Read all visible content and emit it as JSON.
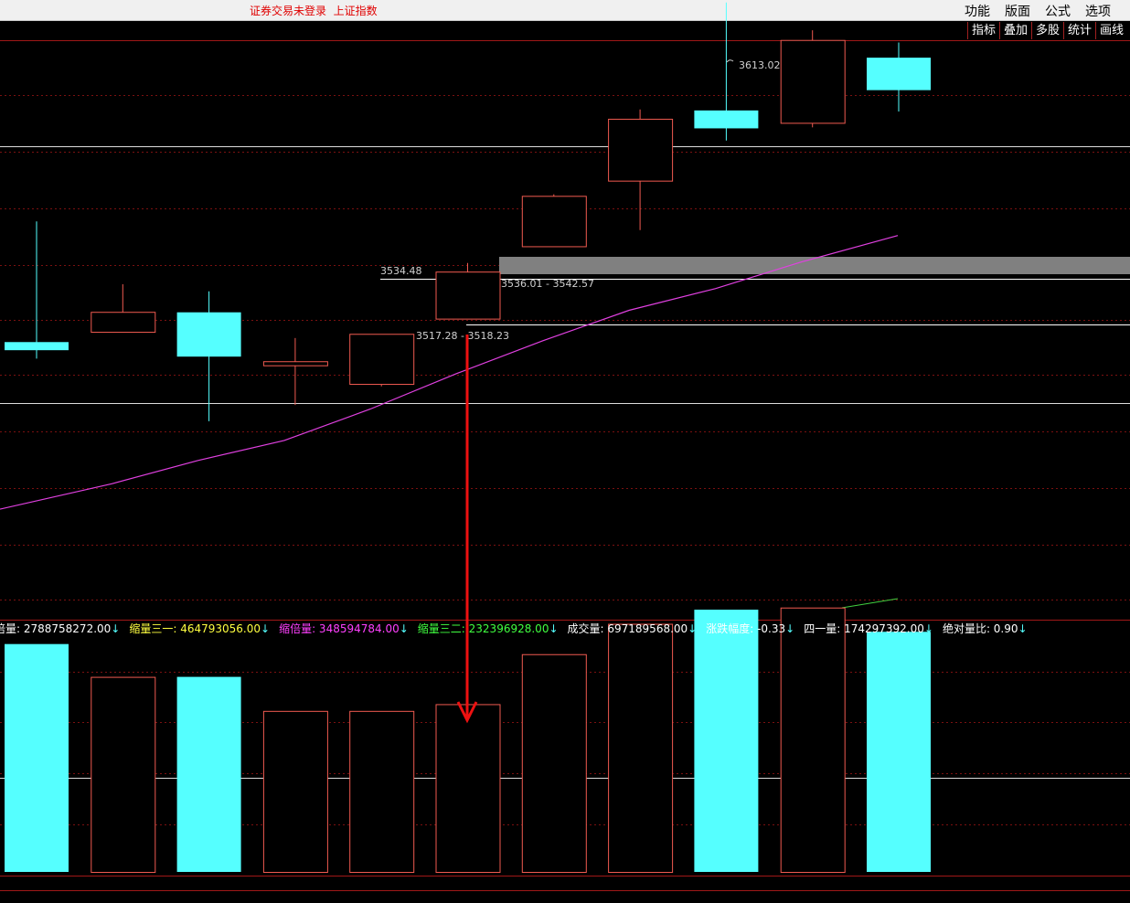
{
  "topbar": {
    "status": "证券交易未登录  上证指数",
    "menu": [
      "功能",
      "版面",
      "公式",
      "选项"
    ]
  },
  "tools": [
    "指标",
    "叠加",
    "多股",
    "统计",
    "画线"
  ],
  "colors": {
    "up": "#f05a50",
    "down": "#55ffff",
    "ma": "#e040e0",
    "grid": "#7a1010",
    "arrow": "#ee1111"
  },
  "chart_data": [
    {
      "type": "candlestick",
      "annotations": {
        "high_label": "3613.02",
        "level_label": "3534.48",
        "range_label_1": "3536.01 - 3542.57",
        "range_label_2": "3517.28 - 3518.23"
      },
      "candles": [
        {
          "open": 3512.6,
          "close": 3510.2,
          "high": 3548.3,
          "low": 3507.7,
          "dir": "down"
        },
        {
          "open": 3515.5,
          "close": 3521.4,
          "high": 3529.7,
          "low": 3515.5,
          "dir": "up"
        },
        {
          "open": 3521.4,
          "close": 3508.3,
          "high": 3527.6,
          "low": 3489.2,
          "dir": "down"
        },
        {
          "open": 3505.6,
          "close": 3506.8,
          "high": 3513.8,
          "low": 3494.0,
          "dir": "up"
        },
        {
          "open": 3500.1,
          "close": 3514.9,
          "high": 3514.9,
          "low": 3499.5,
          "dir": "up"
        },
        {
          "open": 3519.4,
          "close": 3533.3,
          "high": 3536.0,
          "low": 3519.4,
          "dir": "up"
        },
        {
          "open": 3540.8,
          "close": 3555.7,
          "high": 3556.3,
          "low": 3540.8,
          "dir": "up"
        },
        {
          "open": 3560.2,
          "close": 3578.5,
          "high": 3581.4,
          "low": 3545.7,
          "dir": "up"
        },
        {
          "open": 3581.1,
          "close": 3575.8,
          "high": 3613.0,
          "low": 3572.2,
          "dir": "down"
        },
        {
          "open": 3577.3,
          "close": 3601.8,
          "high": 3604.8,
          "low": 3576.1,
          "dir": "up"
        },
        {
          "open": 3596.7,
          "close": 3587.1,
          "high": 3601.2,
          "low": 3580.8,
          "dir": "down"
        }
      ],
      "ma_line": [
        3463.2,
        3470.7,
        3477.6,
        3483.5,
        3492.8,
        3503.3,
        3513.0,
        3522.0,
        3528.4,
        3536.3,
        3544.1
      ]
    },
    {
      "type": "bar",
      "legend": [
        {
          "label": "倍量: 2788758272.00",
          "arrow": "↓",
          "color": "#ffffff"
        },
        {
          "label": "缩量三一: 464793056.00",
          "arrow": "↓",
          "color": "#ffff40"
        },
        {
          "label": "缩倍量: 348594784.00",
          "arrow": "↓",
          "color": "#ff40ff"
        },
        {
          "label": "缩量三二: 232396928.00",
          "arrow": "↓",
          "color": "#40ff40"
        },
        {
          "label": "成交量: 697189568.00",
          "arrow": "↓",
          "color": "#ffffff"
        },
        {
          "label": "涨跌幅度: -0.33",
          "arrow": "↓",
          "color": "#ffffff"
        },
        {
          "label": "四一量: 174297392.00",
          "arrow": "↓",
          "color": "#ffffff"
        },
        {
          "label": "绝对量比: 0.90",
          "arrow": "↓",
          "color": "#ffffff"
        }
      ],
      "volumes": [
        {
          "value": 743000000.0,
          "dir": "down"
        },
        {
          "value": 636000000.0,
          "dir": "up"
        },
        {
          "value": 636000000.0,
          "dir": "down"
        },
        {
          "value": 525000000.0,
          "dir": "up"
        },
        {
          "value": 525000000.0,
          "dir": "up"
        },
        {
          "value": 547000000.0,
          "dir": "up"
        },
        {
          "value": 710000000.0,
          "dir": "up"
        },
        {
          "value": 809000000.0,
          "dir": "up"
        },
        {
          "value": 855000000.0,
          "dir": "down"
        },
        {
          "value": 862000000.0,
          "dir": "up"
        },
        {
          "value": 783000000.0,
          "dir": "down"
        }
      ]
    }
  ]
}
